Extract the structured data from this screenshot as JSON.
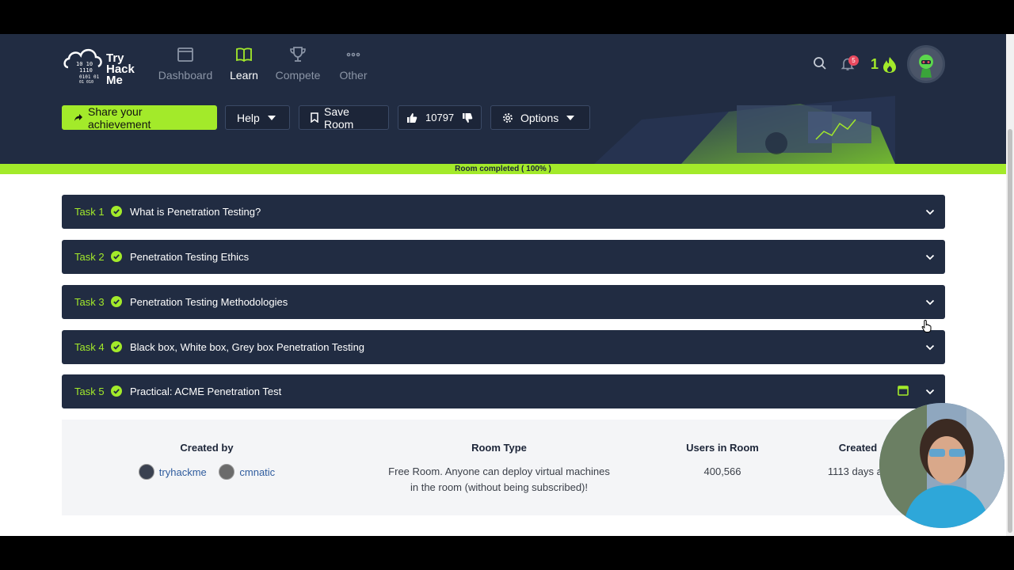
{
  "logo": {
    "line1": "Try",
    "line2": "Hack",
    "line3": "Me"
  },
  "nav": {
    "items": [
      {
        "label": "Dashboard",
        "icon": "window-icon"
      },
      {
        "label": "Learn",
        "icon": "book-icon"
      },
      {
        "label": "Compete",
        "icon": "trophy-icon"
      },
      {
        "label": "Other",
        "icon": "more-icon"
      }
    ],
    "notifications_count": "5",
    "streak": "1"
  },
  "toolbar": {
    "share_label": "Share your achievement",
    "help_label": "Help",
    "save_label": "Save Room",
    "likes": "10797",
    "options_label": "Options"
  },
  "progress": {
    "label": "Room completed ( 100% )",
    "value": 1.0
  },
  "tasks": [
    {
      "number": "Task 1",
      "title": "What is Penetration Testing?"
    },
    {
      "number": "Task 2",
      "title": "Penetration Testing Ethics"
    },
    {
      "number": "Task 3",
      "title": "Penetration Testing Methodologies"
    },
    {
      "number": "Task 4",
      "title": "Black box, White box, Grey box Penetration Testing"
    },
    {
      "number": "Task 5",
      "title": "Practical: ACME Penetration Test"
    }
  ],
  "room_info": {
    "created_by_label": "Created by",
    "creators": [
      "tryhackme",
      "cmnatic"
    ],
    "room_type_label": "Room Type",
    "room_type_line1": "Free Room. Anyone can deploy virtual machines",
    "room_type_line2": "in the room (without being subscribed)!",
    "users_label": "Users in Room",
    "users_value": "400,566",
    "created_label": "Created",
    "created_value": "1113 days ag"
  },
  "colors": {
    "navy": "#212c42",
    "accent": "#a3ea2a",
    "link": "#2f5c9e"
  }
}
